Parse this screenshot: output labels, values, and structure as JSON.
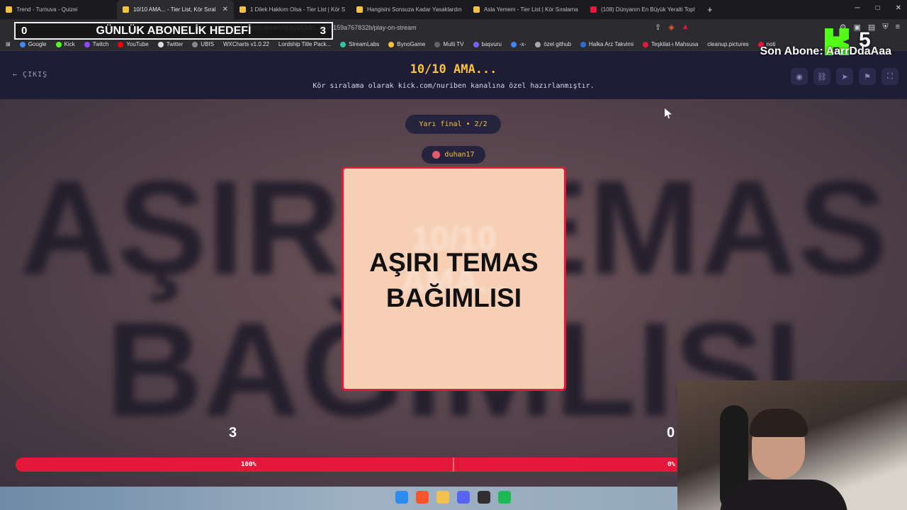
{
  "tabs": [
    {
      "label": "Trend - Turnuva - Quizei",
      "color": "#f5c242",
      "active": false
    },
    {
      "label": "10/10 AMA... - Tier List, Kör Sıral",
      "color": "#f5c242",
      "active": true
    },
    {
      "label": "1 Dilek Hakkım Olsa - Tier List | Kör S",
      "color": "#f5c242",
      "active": false
    },
    {
      "label": "Hangisini Sonsuza Kadar Yasaklardın",
      "color": "#f5c242",
      "active": false
    },
    {
      "label": "Asla Yemem - Tier List | Kör Sıralama",
      "color": "#f5c242",
      "active": false
    },
    {
      "label": "(108) Dünyanın En Büyük Yeralti Topl",
      "color": "#e3183a",
      "active": false
    }
  ],
  "address": {
    "url": "ournament/quiz/683dc...c609159a767832b/play-on-stream"
  },
  "bookmarks": [
    "Google",
    "Kick",
    "Twitch",
    "YouTube",
    "Twitter",
    "UBIS",
    "WXCharts v1.0.22",
    "Lordship Title Pack...",
    "StreamLabs",
    "BynoGame",
    "Multi TV",
    "başvuru",
    "-x-",
    "özel github",
    "Halka Arz Takvimi",
    "Teşkilat-ı Mahsusa",
    "cleanup.pictures",
    "noti"
  ],
  "overlay": {
    "goal_left": "0",
    "goal_title": "GÜNLÜK ABONELİK HEDEFİ",
    "goal_right": "3",
    "kick_count": "5",
    "last_sub": "Son Abone: AarrDdaAaa"
  },
  "app": {
    "exit_label": "ÇIKIŞ",
    "title": "10/10 AMA...",
    "subtitle": "Kör sıralama olarak kick.com/nuriben kanalına özel hazırlanmıştır.",
    "round": "Yarı final • 2/2",
    "user": "duhan17",
    "bg_line1": "AŞIRI TEMAS",
    "bg_line2": "BAĞIMLISI",
    "card_ghost1": "10/10",
    "card_ghost2": "AMA...",
    "card_line1": "AŞIRI TEMAS",
    "card_line2": "BAĞIMLISI",
    "score_left": "3",
    "score_right": "0",
    "pct_left": "100%",
    "pct_right": "0%",
    "progress_left": 1.0,
    "accent": "#e3183a",
    "title_color": "#f5c242"
  },
  "taskbar": {
    "icons": [
      "windows-icon",
      "brave-icon",
      "folder-icon",
      "discord-icon",
      "obs-icon",
      "spotify-icon"
    ]
  }
}
